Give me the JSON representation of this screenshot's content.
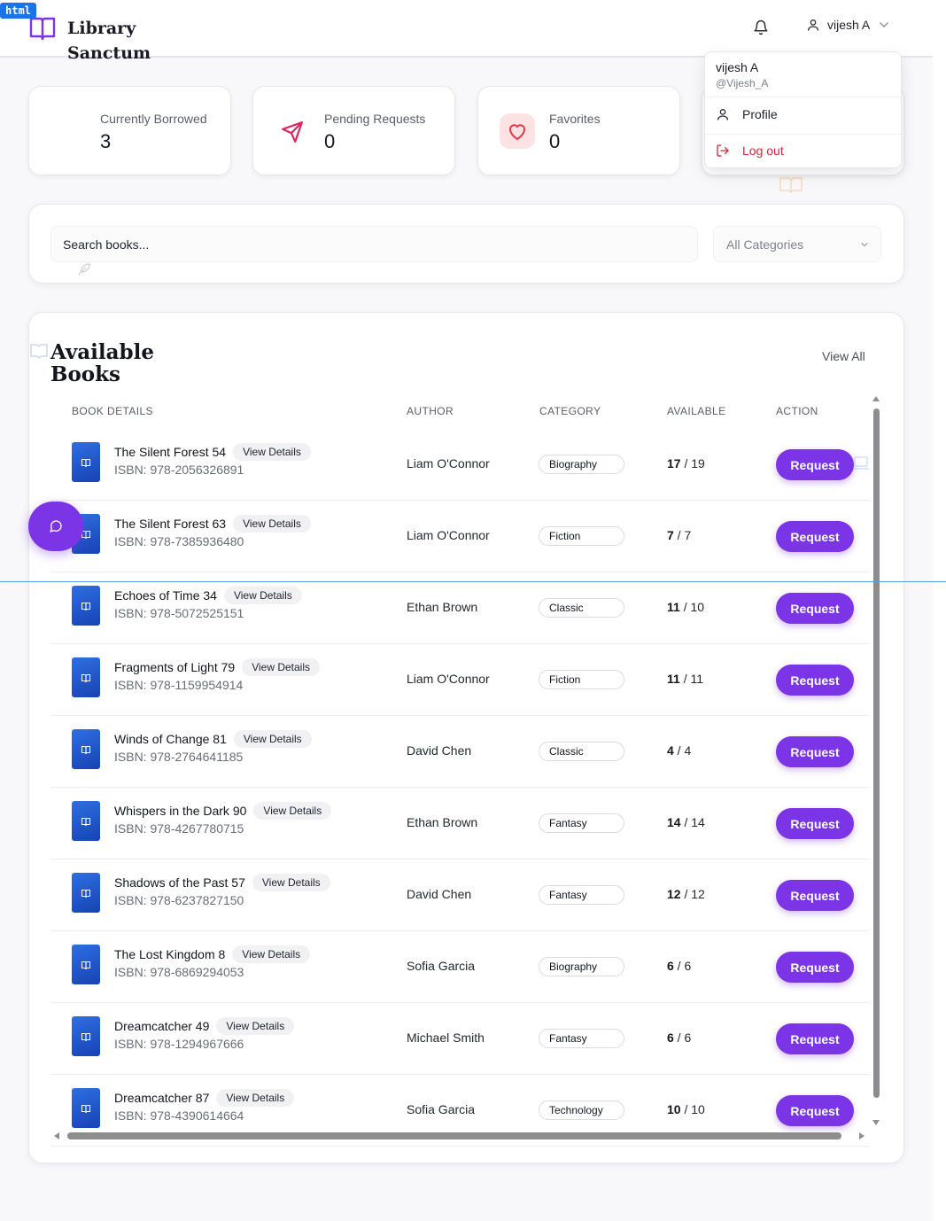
{
  "devtag": "html",
  "app": {
    "name": "Library Sanctum"
  },
  "user": {
    "name": "vijesh A",
    "handle": "@Vijesh_A"
  },
  "user_menu": {
    "profile": "Profile",
    "logout": "Log out"
  },
  "stats": [
    {
      "label": "Currently Borrowed",
      "value": "3"
    },
    {
      "label": "Pending Requests",
      "value": "0"
    },
    {
      "label": "Favorites",
      "value": "0"
    }
  ],
  "search": {
    "placeholder": "Search books...",
    "category": "All Categories"
  },
  "books": {
    "title": "Available Books",
    "view_all": "View All",
    "columns": {
      "details": "BOOK DETAILS",
      "author": "AUTHOR",
      "category": "CATEGORY",
      "available": "AVAILABLE",
      "action": "ACTION"
    },
    "view_details_label": "View Details",
    "request_label": "Request",
    "rows": [
      {
        "title": "The Silent Forest 54",
        "isbn": "ISBN: 978-2056326891",
        "author": "Liam O'Connor",
        "category": "Biography",
        "available": "17",
        "total": "19"
      },
      {
        "title": "The Silent Forest 63",
        "isbn": "ISBN: 978-7385936480",
        "author": "Liam O'Connor",
        "category": "Fiction",
        "available": "7",
        "total": "7"
      },
      {
        "title": "Echoes of Time 34",
        "isbn": "ISBN: 978-5072525151",
        "author": "Ethan Brown",
        "category": "Classic",
        "available": "11",
        "total": "10"
      },
      {
        "title": "Fragments of Light 79",
        "isbn": "ISBN: 978-1159954914",
        "author": "Liam O'Connor",
        "category": "Fiction",
        "available": "11",
        "total": "11"
      },
      {
        "title": "Winds of Change 81",
        "isbn": "ISBN: 978-2764641185",
        "author": "David Chen",
        "category": "Classic",
        "available": "4",
        "total": "4"
      },
      {
        "title": "Whispers in the Dark 90",
        "isbn": "ISBN: 978-4267780715",
        "author": "Ethan Brown",
        "category": "Fantasy",
        "available": "14",
        "total": "14"
      },
      {
        "title": "Shadows of the Past 57",
        "isbn": "ISBN: 978-6237827150",
        "author": "David Chen",
        "category": "Fantasy",
        "available": "12",
        "total": "12"
      },
      {
        "title": "The Lost Kingdom 8",
        "isbn": "ISBN: 978-6869294053",
        "author": "Sofia Garcia",
        "category": "Biography",
        "available": "6",
        "total": "6"
      },
      {
        "title": "Dreamcatcher 49",
        "isbn": "ISBN: 978-1294967666",
        "author": "Michael Smith",
        "category": "Fantasy",
        "available": "6",
        "total": "6"
      },
      {
        "title": "Dreamcatcher 87",
        "isbn": "ISBN: 978-4390614664",
        "author": "Sofia Garcia",
        "category": "Technology",
        "available": "10",
        "total": "10"
      }
    ]
  },
  "colors": {
    "accent": "#7b34e6",
    "danger": "#d3263a",
    "book_cover": "#1f4fc4"
  },
  "icons": [
    "book-open-icon",
    "bell-icon",
    "user-icon",
    "chevron-down-icon",
    "send-icon",
    "heart-icon",
    "logout-icon",
    "feather-icon",
    "chat-icon"
  ]
}
